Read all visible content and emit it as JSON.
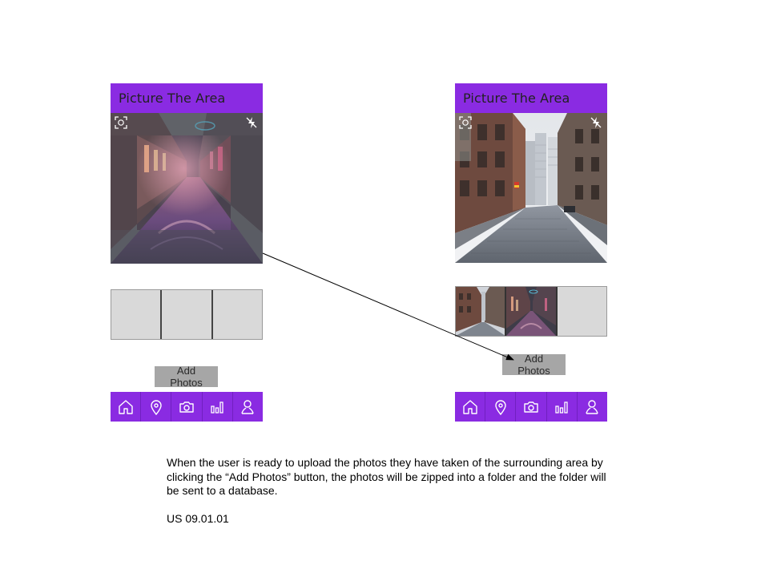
{
  "screens": [
    {
      "id": "before",
      "title": "Picture The Area",
      "camera_view": "dim alley at night with neon lights and wet cobblestones",
      "thumbnails": [
        "empty",
        "empty",
        "empty"
      ],
      "add_button_label": "Add Photos",
      "nav_items": [
        "home-icon",
        "location-pin-icon",
        "camera-icon",
        "stats-icon",
        "profile-icon"
      ]
    },
    {
      "id": "after",
      "title": "Picture The Area",
      "camera_view": "daytime city street with brick buildings and skyscrapers",
      "thumbnails": [
        "daytime street photo",
        "night alley photo",
        "empty"
      ],
      "add_button_label": "Add Photos",
      "nav_items": [
        "home-icon",
        "location-pin-icon",
        "camera-icon",
        "stats-icon",
        "profile-icon"
      ]
    }
  ],
  "viewfinder_icons": [
    "capture-frame-icon",
    "flash-off-icon"
  ],
  "description": "When the user is ready to upload the photos they have taken of the surrounding area by clicking the “Add Photos” button, the photos will be zipped into a folder and the folder will be sent to a database.",
  "story_id": "US 09.01.01",
  "colors": {
    "brand_purple": "#8a2be2",
    "button_gray": "#a6a6a6",
    "slot_gray": "#d9d9d9"
  }
}
